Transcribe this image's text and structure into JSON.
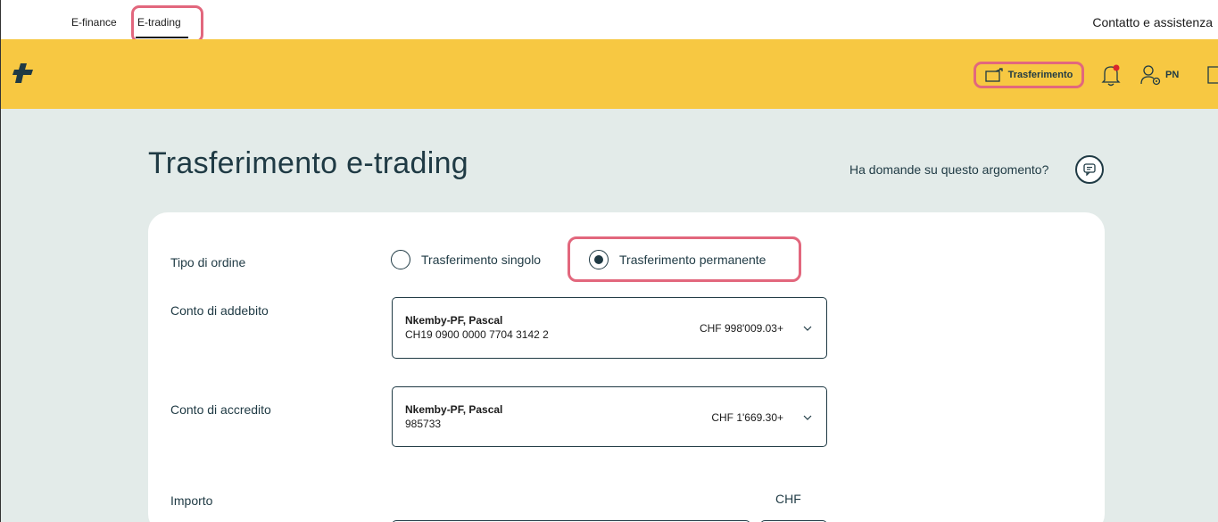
{
  "topnav": {
    "tabs": [
      {
        "label": "E-finance"
      },
      {
        "label": "E-trading"
      }
    ],
    "contact_label": "Contatto e assistenza"
  },
  "header": {
    "transfer_label": "Trasferimento",
    "user_initials": "PN"
  },
  "page": {
    "title": "Trasferimento e-trading",
    "help_text": "Ha domande su questo argomento?"
  },
  "form": {
    "order_type_label": "Tipo di ordine",
    "order_types": [
      {
        "label": "Trasferimento singolo",
        "selected": false
      },
      {
        "label": "Trasferimento permanente",
        "selected": true
      }
    ],
    "debit_label": "Conto di addebito",
    "debit_account": {
      "name": "Nkemby-PF, Pascal",
      "number": "CH19 0900 0000 7704 3142 2",
      "balance": "CHF 998'009.03+"
    },
    "credit_label": "Conto di accredito",
    "credit_account": {
      "name": "Nkemby-PF, Pascal",
      "number": "985733",
      "balance": "CHF 1'669.30+"
    },
    "amount_label": "Importo",
    "currency_label": "CHF"
  },
  "colors": {
    "header_yellow": "#f7c842",
    "highlight": "#e2677d",
    "text_dark": "#1f3a44",
    "page_bg": "#e3ebe9"
  }
}
